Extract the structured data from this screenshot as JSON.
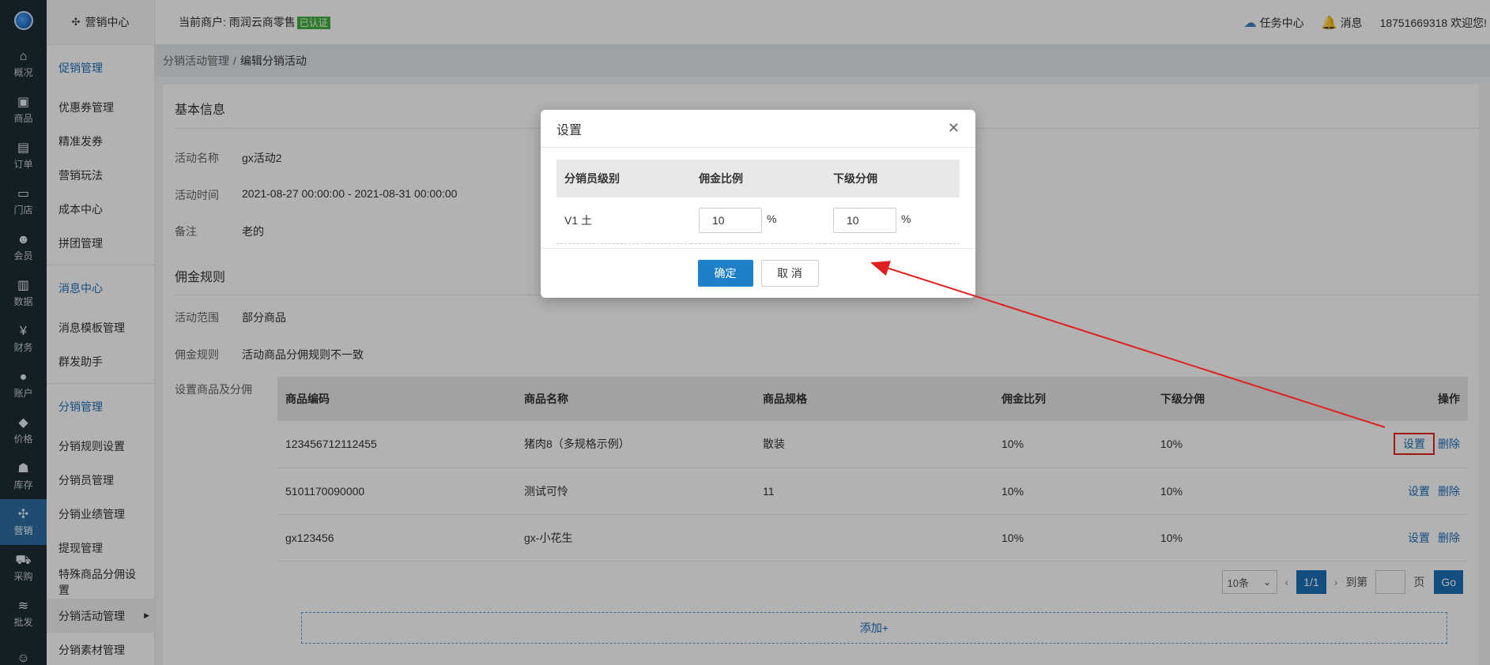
{
  "rail": {
    "items": [
      {
        "label": "概况",
        "icon": "overview-icon",
        "glyph": "⌂"
      },
      {
        "label": "商品",
        "icon": "goods-icon",
        "glyph": "▣"
      },
      {
        "label": "订单",
        "icon": "order-icon",
        "glyph": "▤"
      },
      {
        "label": "门店",
        "icon": "store-icon",
        "glyph": "▭"
      },
      {
        "label": "会员",
        "icon": "member-icon",
        "glyph": "☻"
      },
      {
        "label": "数据",
        "icon": "data-icon",
        "glyph": "▥"
      },
      {
        "label": "财务",
        "icon": "finance-icon",
        "glyph": "¥"
      },
      {
        "label": "账户",
        "icon": "account-icon",
        "glyph": "●"
      },
      {
        "label": "价格",
        "icon": "price-icon",
        "glyph": "◆"
      },
      {
        "label": "库存",
        "icon": "stock-icon",
        "glyph": "☗"
      },
      {
        "label": "营销",
        "icon": "marketing-icon",
        "glyph": "✣"
      },
      {
        "label": "采购",
        "icon": "purchase-icon",
        "glyph": "⛟"
      },
      {
        "label": "批发",
        "icon": "wholesale-icon",
        "glyph": "≋"
      },
      {
        "label": "",
        "icon": "user-icon",
        "glyph": "☺"
      }
    ]
  },
  "menu": {
    "title": "营销中心",
    "groups": [
      {
        "title": "促销管理",
        "items": [
          "优惠券管理",
          "精准发券",
          "营销玩法",
          "成本中心",
          "拼团管理"
        ]
      },
      {
        "title": "消息中心",
        "items": [
          "消息模板管理",
          "群发助手"
        ]
      },
      {
        "title": "分销管理",
        "items": [
          "分销规则设置",
          "分销员管理",
          "分销业绩管理",
          "提现管理",
          "特殊商品分佣设置",
          "分销活动管理",
          "分销素材管理"
        ]
      }
    ]
  },
  "topbar": {
    "merchant_label": "当前商户: 雨润云商零售",
    "verified": "已认证",
    "task_center": "任务中心",
    "messages": "消息",
    "user": "18751669318 欢迎您!"
  },
  "breadcrumb": {
    "parent": "分销活动管理",
    "sep": "/",
    "current": "编辑分销活动"
  },
  "basic": {
    "title": "基本信息",
    "name_label": "活动名称",
    "name_value": "gx活动2",
    "time_label": "活动时间",
    "time_value": "2021-08-27 00:00:00 - 2021-08-31 00:00:00",
    "note_label": "备注",
    "note_value": "老的"
  },
  "rules": {
    "title": "佣金规则",
    "scope_label": "活动范围",
    "scope_value": "部分商品",
    "rule_label": "佣金规则",
    "rule_value": "活动商品分佣规则不一致",
    "goods_label": "设置商品及分佣"
  },
  "goods_table": {
    "headers": [
      "商品编码",
      "商品名称",
      "商品规格",
      "佣金比列",
      "下级分佣",
      "操作"
    ],
    "rows": [
      {
        "code": "123456712112455",
        "name": "猪肉8（多规格示例）",
        "spec": "散装",
        "rate": "10%",
        "sub": "10%"
      },
      {
        "code": "5101170090000",
        "name": "测试可怜",
        "spec": "11",
        "rate": "10%",
        "sub": "10%"
      },
      {
        "code": "gx123456",
        "name": "gx-小花生",
        "spec": "",
        "rate": "10%",
        "sub": "10%"
      }
    ],
    "op_set": "设置",
    "op_delete": "删除"
  },
  "pager": {
    "page_size": "10条",
    "current": "1/1",
    "goto": "到第",
    "page": "页",
    "go": "Go"
  },
  "add_button": "添加+",
  "dialog": {
    "title": "设置",
    "headers": [
      "分销员级别",
      "佣金比例",
      "下级分佣"
    ],
    "rows": [
      {
        "level": "V1 土",
        "rate": "10",
        "sub": "10"
      }
    ],
    "unit": "%",
    "ok": "确定",
    "cancel": "取 消"
  },
  "colors": {
    "accent": "#1e6fb8",
    "annotation": "#e02020",
    "verified": "#3eb13e"
  }
}
